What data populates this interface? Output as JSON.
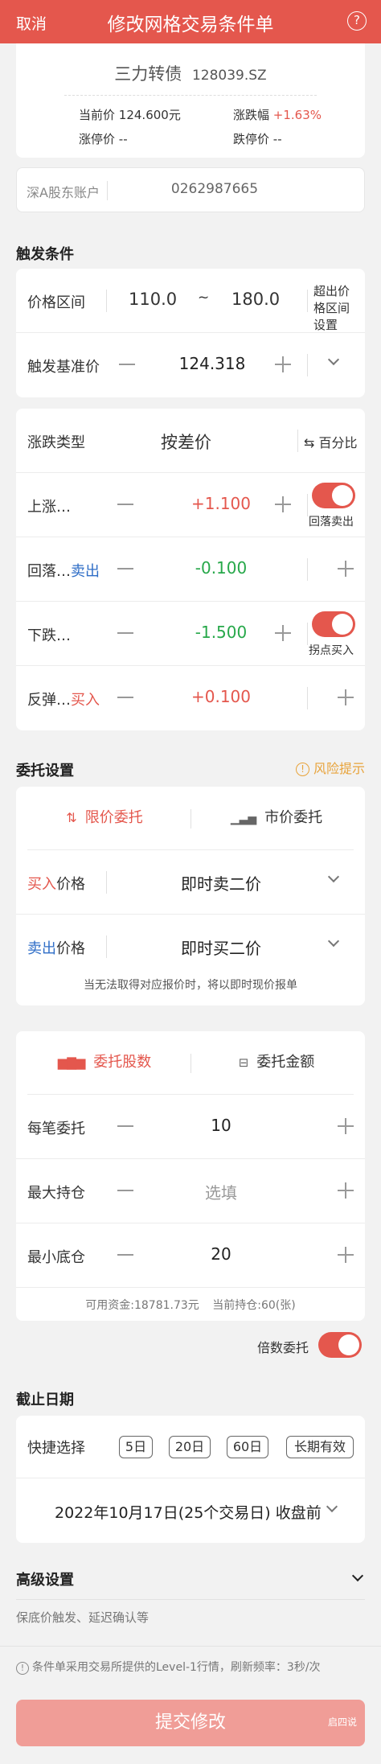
{
  "header": {
    "cancel": "取消",
    "title": "修改网格交易条件单",
    "help": "?"
  },
  "bond": {
    "name": "三力转债",
    "code": "128039.SZ",
    "current_label": "当前价",
    "current_value": "124.600元",
    "change_label": "涨跌幅",
    "change_value": "+1.63%",
    "limit_up_label": "涨停价",
    "limit_up_value": "--",
    "limit_down_label": "跌停价",
    "limit_down_value": "--"
  },
  "account": {
    "label": "深A股东账户",
    "number": "0262987665"
  },
  "trigger": {
    "section": "触发条件",
    "range_label": "价格区间",
    "range_low": "110.0",
    "range_sep": "~",
    "range_high": "180.0",
    "range_setting": "超出价格区间设置",
    "base_label": "触发基准价",
    "base_value": "124.318"
  },
  "change": {
    "type_label": "涨跌类型",
    "type_value": "按差价",
    "switch_label": "⇆ 百分比",
    "rise_label": "上涨…",
    "rise_value": "+1.100",
    "rise_toggle": "回落卖出",
    "fall_back_label": "回落…",
    "fall_back_action": "卖出",
    "fall_back_value": "-0.100",
    "fall_label": "下跌…",
    "fall_value": "-1.500",
    "fall_toggle": "拐点买入",
    "rebound_label": "反弹…",
    "rebound_action": "买入",
    "rebound_value": "+0.100"
  },
  "order": {
    "section": "委托设置",
    "risk": "风险提示",
    "tab_limit": "限价委托",
    "tab_market": "市价委托",
    "buy_prefix": "买入",
    "buy_suffix": "价格",
    "buy_value": "即时卖二价",
    "sell_prefix": "卖出",
    "sell_suffix": "价格",
    "sell_value": "即时买二价",
    "note": "当无法取得对应报价时，将以即时现价报单"
  },
  "qty": {
    "tab_shares": "委托股数",
    "tab_amount": "委托金额",
    "each_label": "每笔委托",
    "each_value": "10",
    "max_label": "最大持仓",
    "max_placeholder": "选填",
    "min_label": "最小底仓",
    "min_value": "20",
    "funds": "可用资金:18781.73元",
    "holding": "当前持仓:60(张)",
    "multiple": "倍数委托"
  },
  "deadline": {
    "section": "截止日期",
    "quick_label": "快捷选择",
    "opt1": "5日",
    "opt2": "20日",
    "opt3": "60日",
    "opt4": "长期有效",
    "date": "2022年10月17日(25个交易日) 收盘前"
  },
  "advanced": {
    "section": "高级设置",
    "desc": "保底价触发、延迟确认等"
  },
  "footer": {
    "note": "条件单采用交易所提供的Level-1行情，刷新频率：3秒/次",
    "watermark": "启四说"
  },
  "submit": "提交修改",
  "colors": {
    "accent": "#e4574d",
    "green": "#27a84a",
    "blue": "#2f6ec7"
  }
}
